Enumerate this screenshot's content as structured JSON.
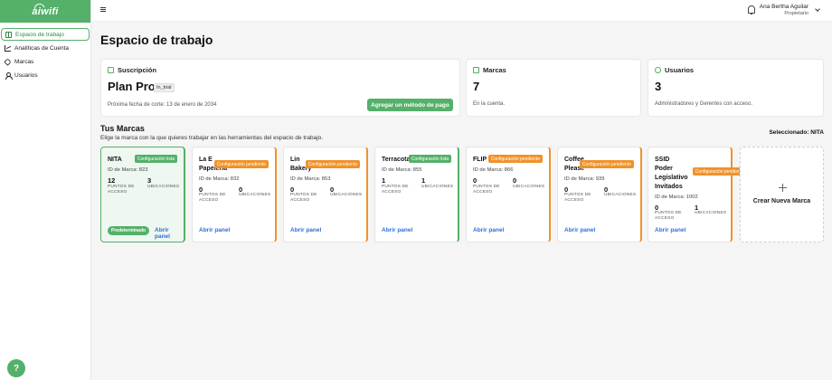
{
  "app": {
    "logo": "aiwifi"
  },
  "sidebar": {
    "items": [
      {
        "label": "Espacio de trabajo",
        "active": true
      },
      {
        "label": "Analíticas de Cuenta",
        "active": false
      },
      {
        "label": "Marcas",
        "active": false
      },
      {
        "label": "Usuarios",
        "active": false
      }
    ],
    "help": "?"
  },
  "user": {
    "name": "Ana Bertha Aguilar",
    "role": "Propietario"
  },
  "page": {
    "title": "Espacio de trabajo"
  },
  "subscription": {
    "heading": "Suscripción",
    "plan": "Plan Pro",
    "badge": "In_trial",
    "cutoff": "Próxima fecha de corte: 13 de enero de 2034",
    "pay_button": "Agregar un método de pago"
  },
  "brands_card": {
    "heading": "Marcas",
    "count": "7",
    "note": "En la cuenta."
  },
  "users_card": {
    "heading": "Usuarios",
    "count": "3",
    "note": "Administradores y Gerentes con acceso."
  },
  "brands_section": {
    "title": "Tus Marcas",
    "subtitle": "Elige la marca con la que quieres trabajar en las herramientas del espacio de trabajo.",
    "selected": "Seleccionado: NITA",
    "points_label": "PUNTOS DE ACCESO",
    "locations_label": "UBICACIONES",
    "open_label": "Abrir panel",
    "default_label": "Predeterminado",
    "create_label": "Crear Nueva Marca",
    "items": [
      {
        "name": "NITA",
        "status": "Configuración lista",
        "id": "ID de Marca: 823",
        "points": "12",
        "locations": "3"
      },
      {
        "name": "La E Papelería",
        "status": "Configuración pendiente",
        "id": "ID de Marca: 832",
        "points": "0",
        "locations": "0"
      },
      {
        "name": "Lin Bakery",
        "status": "Configuración pendiente",
        "id": "ID de Marca: 853",
        "points": "0",
        "locations": "0"
      },
      {
        "name": "Terracota",
        "status": "Configuración lista",
        "id": "ID de Marca: 855",
        "points": "1",
        "locations": "1"
      },
      {
        "name": "FLIP",
        "status": "Configuración pendiente",
        "id": "ID de Marca: 866",
        "points": "0",
        "locations": "0"
      },
      {
        "name": "Coffee Please",
        "status": "Configuración pendiente",
        "id": "ID de Marca: 939",
        "points": "0",
        "locations": "0"
      },
      {
        "name": "SSID Poder Legislativo Invitados",
        "status": "Configuración pendiente",
        "id": "ID de Marca: 1002",
        "points": "0",
        "locations": "1"
      }
    ]
  },
  "colors": {
    "brand_green": "#55b069",
    "pending_orange": "#f0922b",
    "link_blue": "#2f6fd6"
  }
}
